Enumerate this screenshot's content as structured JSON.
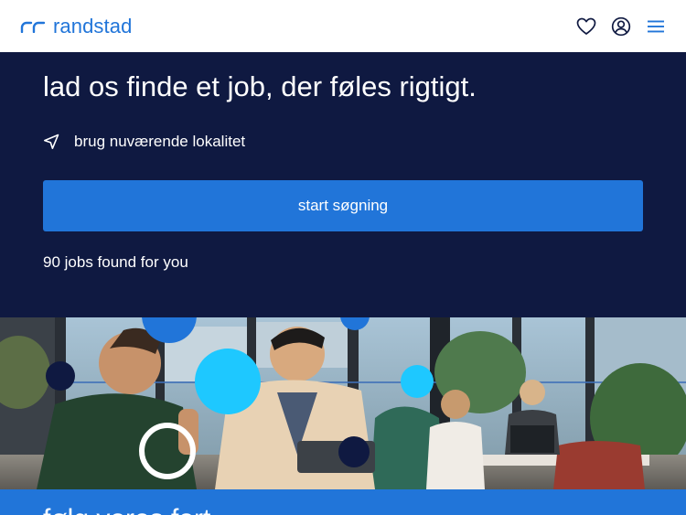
{
  "header": {
    "brand_name": "randstad",
    "icons": [
      "heart-icon",
      "user-account-icon",
      "hamburger-menu-icon"
    ]
  },
  "hero": {
    "title": "lad os finde et job, der føles rigtigt.",
    "location_label": "brug nuværende lokalitet",
    "search_button_label": "start søgning",
    "jobs_found": "90 jobs found for you"
  },
  "bottom": {
    "title": "følg vores fort"
  },
  "colors": {
    "brand_blue": "#2175d9",
    "navy": "#0f1941",
    "white": "#ffffff",
    "accent_cyan": "#1ec8ff"
  }
}
